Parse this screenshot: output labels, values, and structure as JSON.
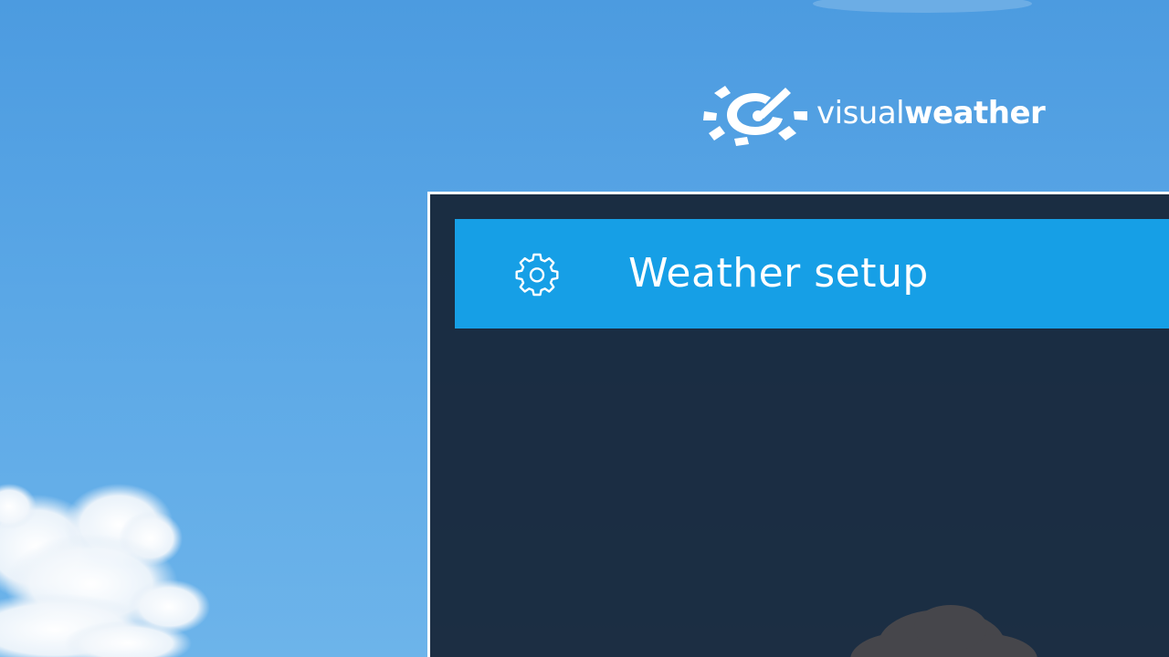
{
  "brand": {
    "name_light": "visual",
    "name_bold": "weather",
    "logo_icon": "visualweather-logo-icon"
  },
  "dialog": {
    "title": "Weather setup",
    "icon": "gear-icon"
  },
  "colors": {
    "sky": "#5aa7e6",
    "panel": "#1f3246",
    "header_bar": "#169fe6",
    "text": "#ffffff"
  }
}
